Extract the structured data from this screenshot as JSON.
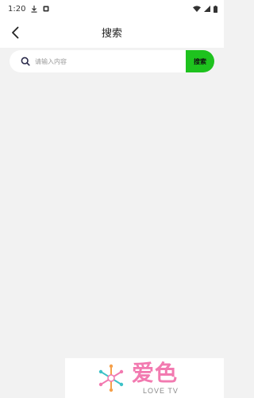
{
  "status_bar": {
    "time": "1:20",
    "icons": [
      "download-icon",
      "notification-icon",
      "wifi-icon",
      "signal-icon",
      "battery-icon"
    ]
  },
  "header": {
    "title": "搜索",
    "back_icon": "chevron-left-icon"
  },
  "search": {
    "placeholder": "请输入内容",
    "value": "",
    "button_label": "搜索",
    "icon": "search-icon"
  },
  "watermark": {
    "title": "爱色",
    "subtitle": "LOVE TV"
  },
  "colors": {
    "accent": "#1ec21e",
    "background": "#f2f2f2",
    "logo_pink": "#f27ab0",
    "logo_orange": "#f5a04a",
    "logo_teal": "#3cc2c8"
  }
}
